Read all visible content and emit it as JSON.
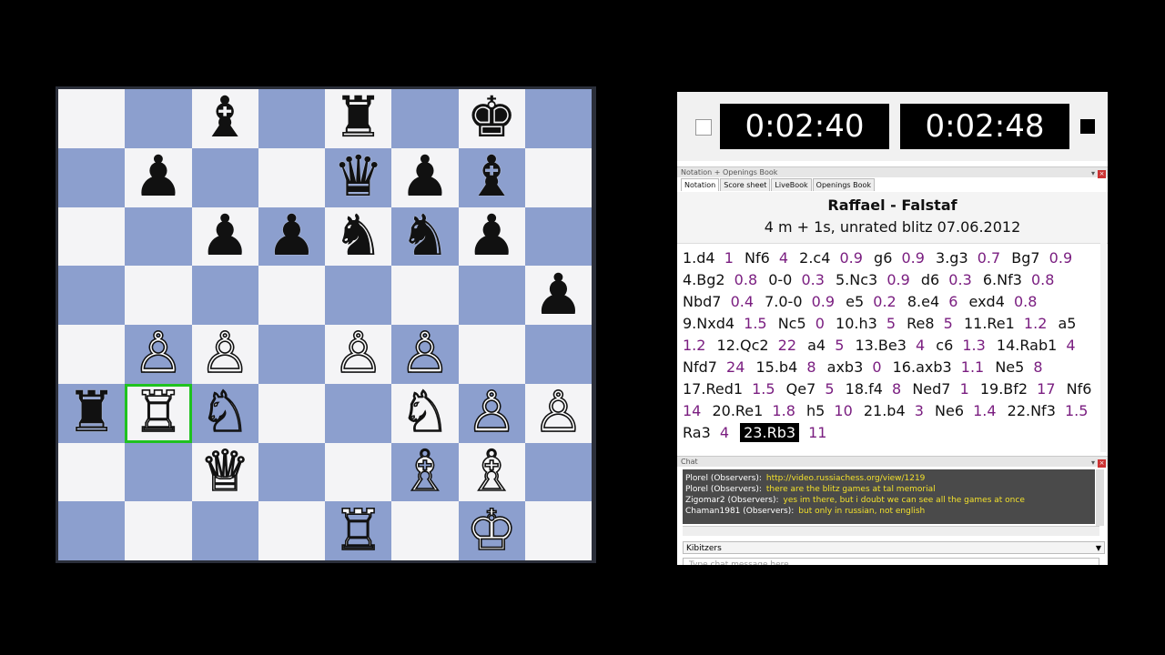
{
  "board": {
    "ranks": [
      [
        null,
        null,
        {
          "p": "♝",
          "c": "b"
        },
        null,
        {
          "p": "♜",
          "c": "b"
        },
        null,
        {
          "p": "♚",
          "c": "b"
        },
        null
      ],
      [
        null,
        {
          "p": "♟",
          "c": "b"
        },
        null,
        null,
        {
          "p": "♛",
          "c": "b"
        },
        {
          "p": "♟",
          "c": "b"
        },
        {
          "p": "♝",
          "c": "b"
        },
        null
      ],
      [
        null,
        null,
        {
          "p": "♟",
          "c": "b"
        },
        {
          "p": "♟",
          "c": "b"
        },
        {
          "p": "♞",
          "c": "b"
        },
        {
          "p": "♞",
          "c": "b"
        },
        {
          "p": "♟",
          "c": "b"
        },
        null
      ],
      [
        null,
        null,
        null,
        null,
        null,
        null,
        null,
        {
          "p": "♟",
          "c": "b"
        }
      ],
      [
        null,
        {
          "p": "♙",
          "c": "w"
        },
        {
          "p": "♙",
          "c": "w"
        },
        null,
        {
          "p": "♙",
          "c": "w"
        },
        {
          "p": "♙",
          "c": "w"
        },
        null,
        null
      ],
      [
        {
          "p": "♜",
          "c": "b"
        },
        {
          "p": "♖",
          "c": "w"
        },
        {
          "p": "♘",
          "c": "w"
        },
        null,
        null,
        {
          "p": "♘",
          "c": "w"
        },
        {
          "p": "♙",
          "c": "w"
        },
        {
          "p": "♙",
          "c": "w"
        }
      ],
      [
        null,
        null,
        {
          "p": "♕",
          "c": "w"
        },
        null,
        null,
        {
          "p": "♗",
          "c": "w"
        },
        {
          "p": "♗",
          "c": "w"
        },
        null
      ],
      [
        null,
        null,
        null,
        null,
        {
          "p": "♖",
          "c": "w"
        },
        null,
        {
          "p": "♔",
          "c": "w"
        },
        null
      ]
    ],
    "highlight_square": "b3",
    "light_color": "#f4f4f6",
    "dark_color": "#8c9fce",
    "highlight_color": "#1fc21f"
  },
  "clocks": {
    "left": "0:02:40",
    "right": "0:02:48"
  },
  "notation_pane": {
    "title": "Notation + Openings Book",
    "tabs": [
      "Notation",
      "Score sheet",
      "LiveBook",
      "Openings Book"
    ],
    "active_tab": 0
  },
  "game": {
    "title": "Raffael - Falstaf",
    "subtitle": "4 m + 1s, unrated blitz 07.06.2012"
  },
  "moves": [
    {
      "m": "1.d4",
      "t": "1"
    },
    {
      "m": "Nf6",
      "t": "4"
    },
    {
      "m": "2.c4",
      "t": "0.9"
    },
    {
      "m": "g6",
      "t": "0.9"
    },
    {
      "m": "3.g3",
      "t": "0.7"
    },
    {
      "m": "Bg7",
      "t": "0.9"
    },
    {
      "m": "4.Bg2",
      "t": "0.8"
    },
    {
      "m": "0-0",
      "t": "0.3"
    },
    {
      "m": "5.Nc3",
      "t": "0.9"
    },
    {
      "m": "d6",
      "t": "0.3"
    },
    {
      "m": "6.Nf3",
      "t": "0.8"
    },
    {
      "m": "Nbd7",
      "t": "0.4"
    },
    {
      "m": "7.0-0",
      "t": "0.9"
    },
    {
      "m": "e5",
      "t": "0.2"
    },
    {
      "m": "8.e4",
      "t": "6"
    },
    {
      "m": "exd4",
      "t": "0.8"
    },
    {
      "m": "9.Nxd4",
      "t": "1.5"
    },
    {
      "m": "Nc5",
      "t": "0"
    },
    {
      "m": "10.h3",
      "t": "5"
    },
    {
      "m": "Re8",
      "t": "5"
    },
    {
      "m": "11.Re1",
      "t": "1.2"
    },
    {
      "m": "a5",
      "t": "1.2"
    },
    {
      "m": "12.Qc2",
      "t": "22"
    },
    {
      "m": "a4",
      "t": "5"
    },
    {
      "m": "13.Be3",
      "t": "4"
    },
    {
      "m": "c6",
      "t": "1.3"
    },
    {
      "m": "14.Rab1",
      "t": "4"
    },
    {
      "m": "Nfd7",
      "t": "24"
    },
    {
      "m": "15.b4",
      "t": "8"
    },
    {
      "m": "axb3",
      "t": "0"
    },
    {
      "m": "16.axb3",
      "t": "1.1"
    },
    {
      "m": "Ne5",
      "t": "8"
    },
    {
      "m": "17.Red1",
      "t": "1.5"
    },
    {
      "m": "Qe7",
      "t": "5"
    },
    {
      "m": "18.f4",
      "t": "8"
    },
    {
      "m": "Ned7",
      "t": "1"
    },
    {
      "m": "19.Bf2",
      "t": "17"
    },
    {
      "m": "Nf6",
      "t": "14"
    },
    {
      "m": "20.Re1",
      "t": "1.8"
    },
    {
      "m": "h5",
      "t": "10"
    },
    {
      "m": "21.b4",
      "t": "3"
    },
    {
      "m": "Ne6",
      "t": "1.4"
    },
    {
      "m": "22.Nf3",
      "t": "1.5"
    },
    {
      "m": "Ra3",
      "t": "4"
    },
    {
      "m": "23.Rb3",
      "t": "11",
      "current": true
    }
  ],
  "chat_pane": {
    "title": "Chat"
  },
  "chat": [
    {
      "user": "Plorel (Observers):",
      "msg": "http://video.russiachess.org/view/1219"
    },
    {
      "user": "Plorel (Observers):",
      "msg": "there are the blitz games at tal memorial"
    },
    {
      "user": "Zigomar2 (Observers):",
      "msg": "yes im there, but i doubt we can see all the games at once"
    },
    {
      "user": "Chaman1981 (Observers):",
      "msg": "but only in russian, not english"
    }
  ],
  "kibitzers": {
    "label": "Kibitzers"
  },
  "chat_input": {
    "placeholder": "Type chat message here"
  }
}
